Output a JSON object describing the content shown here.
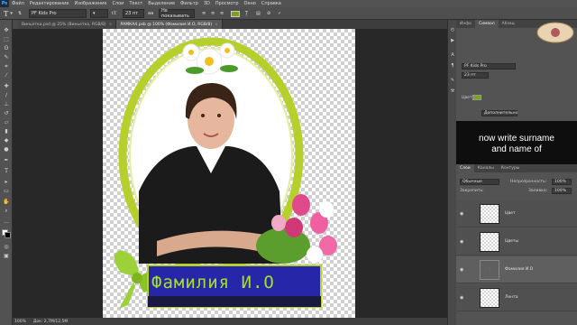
{
  "app": {
    "logo": "Ps",
    "menu": [
      "Файл",
      "Редактирование",
      "Изображение",
      "Слои",
      "Текст",
      "Выделение",
      "Фильтр",
      "3D",
      "Просмотр",
      "Окно",
      "Справка"
    ]
  },
  "options": {
    "font_family": "PF Kids Pro",
    "font_size": "23 пт",
    "antialias": "Не показывать",
    "text_color": "#7ea11b"
  },
  "tabs": [
    {
      "label": "Виньетка.psd @ 25% (Виньетка, RGB/8)",
      "active": false,
      "close": "×"
    },
    {
      "label": "РАМКА4.psb @ 100% (Фамилия И.О, RGB/8)",
      "active": true,
      "close": "×"
    }
  ],
  "status": {
    "zoom": "100%",
    "doc": "Док: 2,7M/12,5M"
  },
  "canvas": {
    "banner_text": "Фамилия И.О"
  },
  "char_panel": {
    "tabs": [
      "Инфо",
      "Символ",
      "Абзац"
    ],
    "font_family": "PF Kids Pro",
    "font_size": "23 пт",
    "color_label": "Цвет:",
    "color": "#7ea11b",
    "extra_label": "Дополнительно"
  },
  "overlay": {
    "line1": "now write surname",
    "line2": "and name of"
  },
  "layers_panel": {
    "tabs": [
      "Слои",
      "Каналы",
      "Контуры"
    ],
    "blend": "Обычные",
    "opacity_label": "Непрозрачность:",
    "opacity": "100%",
    "lock_label": "Закрепить:",
    "fill_label": "Заливка:",
    "fill": "100%",
    "layers": [
      {
        "name": "Цвет",
        "selected": false
      },
      {
        "name": "Цветы",
        "selected": false
      },
      {
        "name": "Фамилия И.О",
        "selected": true
      },
      {
        "name": "Лента",
        "selected": false
      }
    ]
  },
  "watermark": "Kr. Vasi"
}
